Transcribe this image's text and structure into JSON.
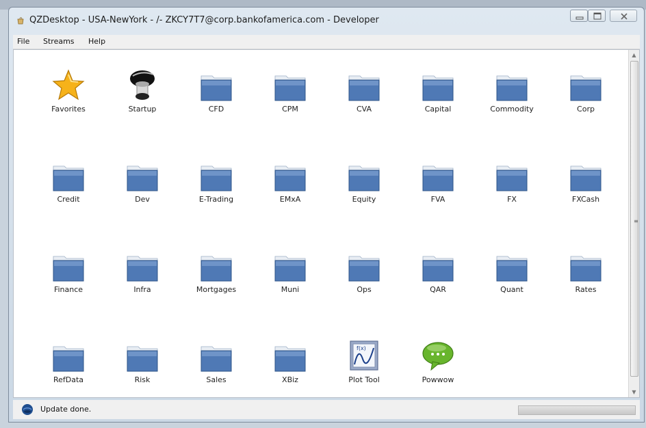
{
  "window": {
    "title": "QZDesktop - USA-NewYork - /- ZKCY7T7@corp.bankofamerica.com - Developer"
  },
  "menu": [
    "File",
    "Streams",
    "Help"
  ],
  "tiles": [
    {
      "label": "Favorites",
      "icon": "star-icon"
    },
    {
      "label": "Startup",
      "icon": "startup-icon"
    },
    {
      "label": "CFD",
      "icon": "folder-icon"
    },
    {
      "label": "CPM",
      "icon": "folder-icon"
    },
    {
      "label": "CVA",
      "icon": "folder-icon"
    },
    {
      "label": "Capital",
      "icon": "folder-icon"
    },
    {
      "label": "Commodity",
      "icon": "folder-icon"
    },
    {
      "label": "Corp",
      "icon": "folder-icon"
    },
    {
      "label": "Credit",
      "icon": "folder-icon"
    },
    {
      "label": "Dev",
      "icon": "folder-icon"
    },
    {
      "label": "E-Trading",
      "icon": "folder-icon"
    },
    {
      "label": "EMxA",
      "icon": "folder-icon"
    },
    {
      "label": "Equity",
      "icon": "folder-icon"
    },
    {
      "label": "FVA",
      "icon": "folder-icon"
    },
    {
      "label": "FX",
      "icon": "folder-icon"
    },
    {
      "label": "FXCash",
      "icon": "folder-icon"
    },
    {
      "label": "Finance",
      "icon": "folder-icon"
    },
    {
      "label": "Infra",
      "icon": "folder-icon"
    },
    {
      "label": "Mortgages",
      "icon": "folder-icon"
    },
    {
      "label": "Muni",
      "icon": "folder-icon"
    },
    {
      "label": "Ops",
      "icon": "folder-icon"
    },
    {
      "label": "QAR",
      "icon": "folder-icon"
    },
    {
      "label": "Quant",
      "icon": "folder-icon"
    },
    {
      "label": "Rates",
      "icon": "folder-icon"
    },
    {
      "label": "RefData",
      "icon": "folder-icon"
    },
    {
      "label": "Risk",
      "icon": "folder-icon"
    },
    {
      "label": "Sales",
      "icon": "folder-icon"
    },
    {
      "label": "XBiz",
      "icon": "folder-icon"
    },
    {
      "label": "Plot Tool",
      "icon": "plot-tool-icon"
    },
    {
      "label": "Powwow",
      "icon": "chat-bubble-icon"
    }
  ],
  "status": {
    "text": "Update done.",
    "icon": "globe-icon"
  },
  "colors": {
    "folder": "#4f79b5",
    "folder_tab": "#e8edf3",
    "star": "#f6b21a",
    "chat": "#68b52d"
  }
}
